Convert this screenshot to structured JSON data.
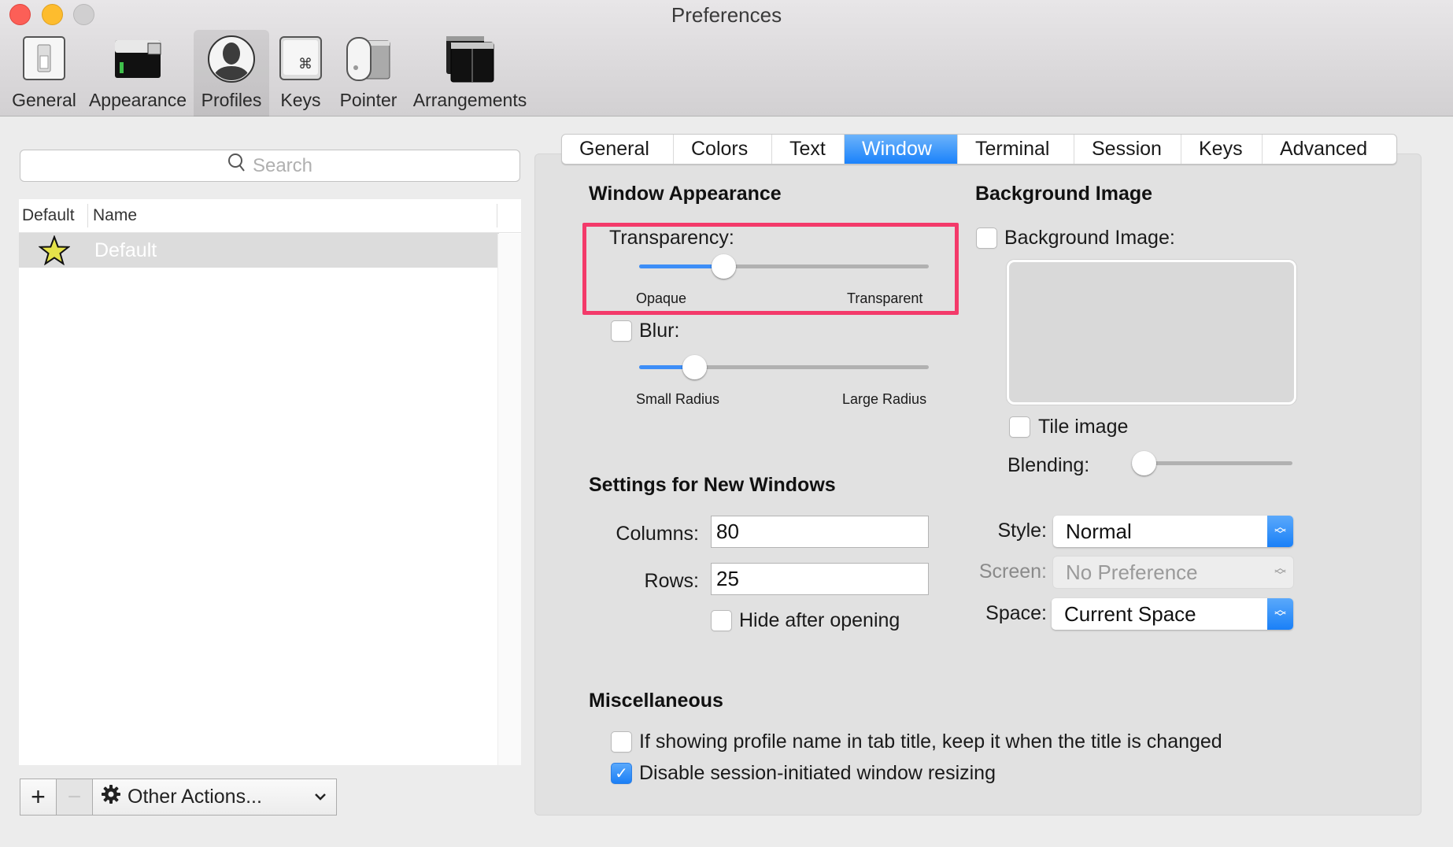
{
  "window": {
    "title": "Preferences",
    "controls": [
      "close",
      "minimize",
      "zoom"
    ]
  },
  "toolbar": {
    "items": [
      {
        "label": "General",
        "icon": "switch-icon",
        "active": false
      },
      {
        "label": "Appearance",
        "icon": "terminal-window-icon",
        "active": false
      },
      {
        "label": "Profiles",
        "icon": "user-silhouette-icon",
        "active": true
      },
      {
        "label": "Keys",
        "icon": "command-key-icon",
        "active": false
      },
      {
        "label": "Pointer",
        "icon": "mouse-icon",
        "active": false
      },
      {
        "label": "Arrangements",
        "icon": "stacked-windows-icon",
        "active": false
      }
    ]
  },
  "profiles": {
    "search_placeholder": "Search",
    "columns": [
      "Default",
      "Name"
    ],
    "rows": [
      {
        "is_default": true,
        "name": "Default",
        "selected": true
      }
    ],
    "add_label": "+",
    "remove_label": "−",
    "other_actions_label": "Other Actions..."
  },
  "tabs": {
    "items": [
      "General",
      "Colors",
      "Text",
      "Window",
      "Terminal",
      "Session",
      "Keys",
      "Advanced"
    ],
    "active": "Window"
  },
  "window_appearance": {
    "heading": "Window Appearance",
    "transparency": {
      "label": "Transparency:",
      "value": 0.29,
      "min_label": "Opaque",
      "max_label": "Transparent",
      "highlighted": true
    },
    "blur": {
      "label": "Blur:",
      "checked": false,
      "value": 0.19,
      "min_label": "Small Radius",
      "max_label": "Large Radius"
    }
  },
  "background_image": {
    "heading": "Background Image",
    "enable_label": "Background Image:",
    "enabled": false,
    "tile_label": "Tile image",
    "tile": false,
    "blending_label": "Blending:",
    "blending": 0.0
  },
  "new_windows": {
    "heading": "Settings for New Windows",
    "columns_label": "Columns:",
    "columns_value": "80",
    "rows_label": "Rows:",
    "rows_value": "25",
    "hide_label": "Hide after opening",
    "hide": false,
    "style_label": "Style:",
    "style_value": "Normal",
    "screen_label": "Screen:",
    "screen_value": "No Preference",
    "screen_disabled": true,
    "space_label": "Space:",
    "space_value": "Current Space"
  },
  "misc": {
    "heading": "Miscellaneous",
    "options": [
      {
        "label": "If showing profile name in tab title, keep it when the title is changed",
        "checked": false
      },
      {
        "label": "Disable session-initiated window resizing",
        "checked": true
      }
    ]
  },
  "colors": {
    "accent": "#1a82fb",
    "highlight_box": "#f33a6a",
    "slider_fill": "#3d8ef7",
    "star_fill": "#e6e34a"
  }
}
